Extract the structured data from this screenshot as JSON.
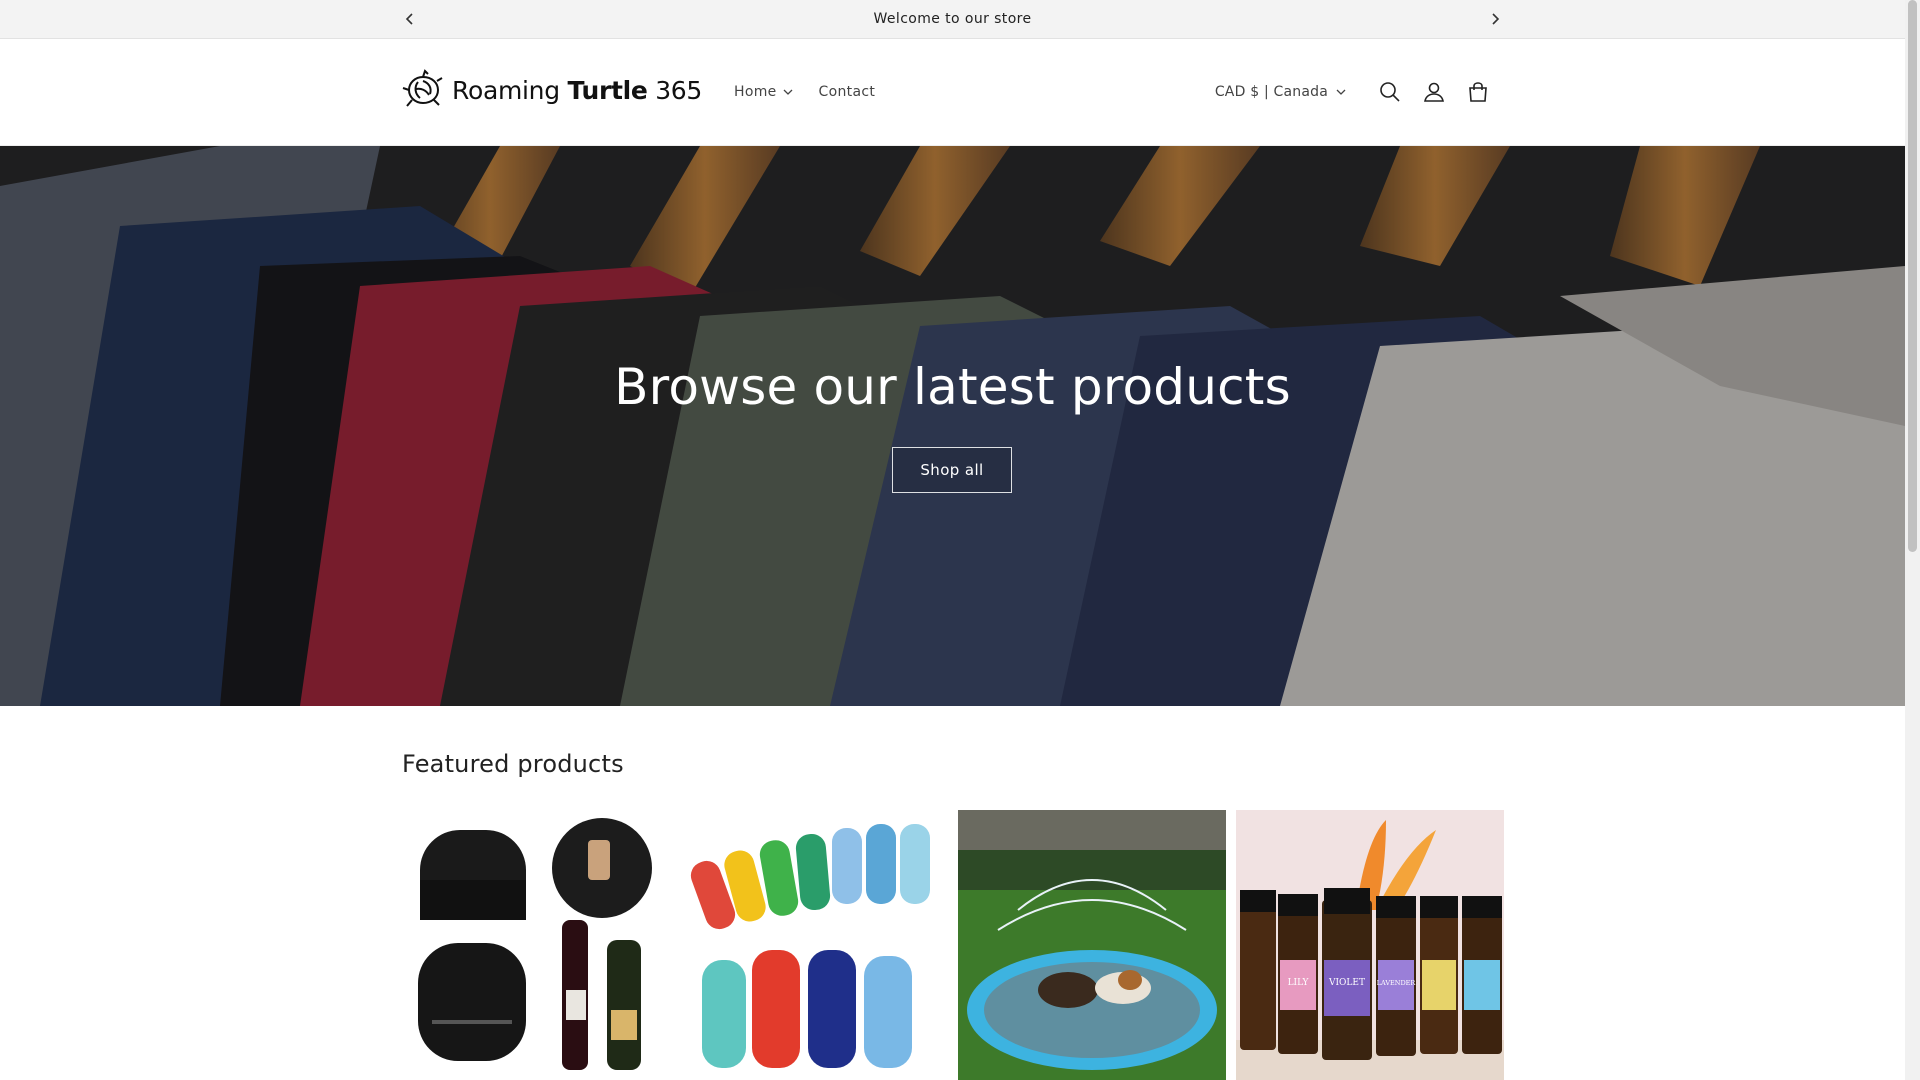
{
  "announcement": {
    "message": "Welcome to our store"
  },
  "header": {
    "logo_text_regular": "Roaming ",
    "logo_text_bold": "Turtle",
    "logo_text_suffix": " 365",
    "nav": [
      {
        "label": "Home",
        "has_dropdown": true
      },
      {
        "label": "Contact",
        "has_dropdown": false
      }
    ],
    "currency": "CAD $ | Canada",
    "icons": [
      "search-icon",
      "account-icon",
      "cart-icon"
    ]
  },
  "hero": {
    "title": "Browse our latest products",
    "button_label": "Shop all"
  },
  "featured": {
    "title": "Featured products",
    "products": [
      {
        "image": "wine-stopper"
      },
      {
        "image": "finger-toothbrush"
      },
      {
        "image": "splash-pad"
      },
      {
        "image": "essential-oils"
      }
    ],
    "oil_labels": [
      "LILY",
      "VIOLET",
      "LAVENDER"
    ]
  },
  "colors": {
    "accent": "#121212",
    "announcement_bg": "#f3f3f3"
  }
}
